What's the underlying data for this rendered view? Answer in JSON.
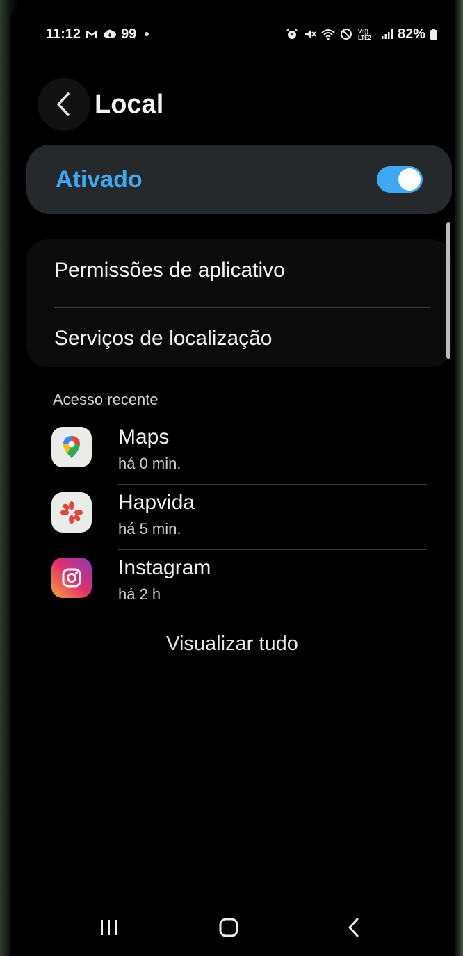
{
  "status_bar": {
    "time": "11:12",
    "notification_count": "99",
    "battery": "82%",
    "volte_label": "Vo))\nLTE2",
    "icons": [
      "gmail-icon",
      "cloud-icon",
      "alarm-icon",
      "mute-icon",
      "wifi-icon",
      "do-not-disturb-icon",
      "volte-icon",
      "signal-icon",
      "battery-icon"
    ]
  },
  "header": {
    "title": "Local"
  },
  "location_toggle": {
    "label": "Ativado",
    "state": "on",
    "accent_color": "#3ea9f2"
  },
  "menu": {
    "items": [
      {
        "label": "Permissões de aplicativo"
      },
      {
        "label": "Serviços de localização"
      }
    ]
  },
  "recent_access": {
    "section_title": "Acesso recente",
    "apps": [
      {
        "name": "Maps",
        "time": "há 0 min.",
        "icon": "google-maps-icon"
      },
      {
        "name": "Hapvida",
        "time": "há 5 min.",
        "icon": "hapvida-icon"
      },
      {
        "name": "Instagram",
        "time": "há 2 h",
        "icon": "instagram-icon"
      }
    ],
    "view_all_label": "Visualizar tudo"
  },
  "nav_bar": {
    "buttons": [
      "recent-apps-icon",
      "home-icon",
      "back-icon"
    ]
  }
}
